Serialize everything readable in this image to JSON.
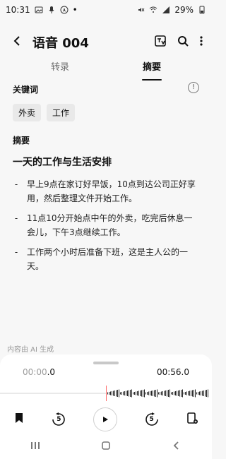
{
  "status_bar": {
    "time": "10:31",
    "battery": "29%"
  },
  "header": {
    "title": "语音 004",
    "icons": [
      "back-icon",
      "translate-icon",
      "search-icon",
      "more-icon"
    ]
  },
  "tabs": [
    {
      "label": "转录",
      "active": false
    },
    {
      "label": "摘要",
      "active": true
    }
  ],
  "keywords": {
    "title": "关键词",
    "items": [
      "外卖",
      "工作"
    ]
  },
  "summary": {
    "label": "摘要",
    "heading": "一天的工作与生活安排",
    "bullets": [
      "早上9点在家订好早饭，10点到达公司正好享用，然后整理文件开始工作。",
      "11点10分开始点中午的外卖，吃完后休息一会儿，下午3点继续工作。",
      "工作两个小时后准备下班，这是主人公的一天。"
    ]
  },
  "ai_note": "内容由 AI 生成",
  "player": {
    "current_time_main": "00:00",
    "current_time_fraction": ".0",
    "total_time": "00:56.0",
    "rewind_seconds": "5",
    "forward_seconds": "5"
  }
}
